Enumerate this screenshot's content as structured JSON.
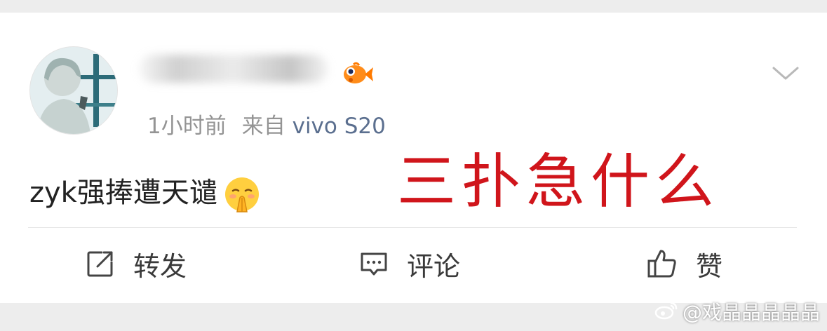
{
  "post": {
    "time": "1小时前",
    "source_prefix": "来自",
    "device": "vivo S20",
    "text": "zyk强捧遭天谴",
    "emoji": "pleading-face-praying-hands"
  },
  "overlay": {
    "text": "三扑急什么",
    "color": "#d0151b"
  },
  "actions": {
    "repost": "转发",
    "comment": "评论",
    "like": "赞"
  },
  "watermark": {
    "text": "@戏晶晶晶晶晶"
  },
  "colors": {
    "device_link": "#5b6f8f",
    "meta_gray": "#949494",
    "page_bg": "#ededed"
  }
}
